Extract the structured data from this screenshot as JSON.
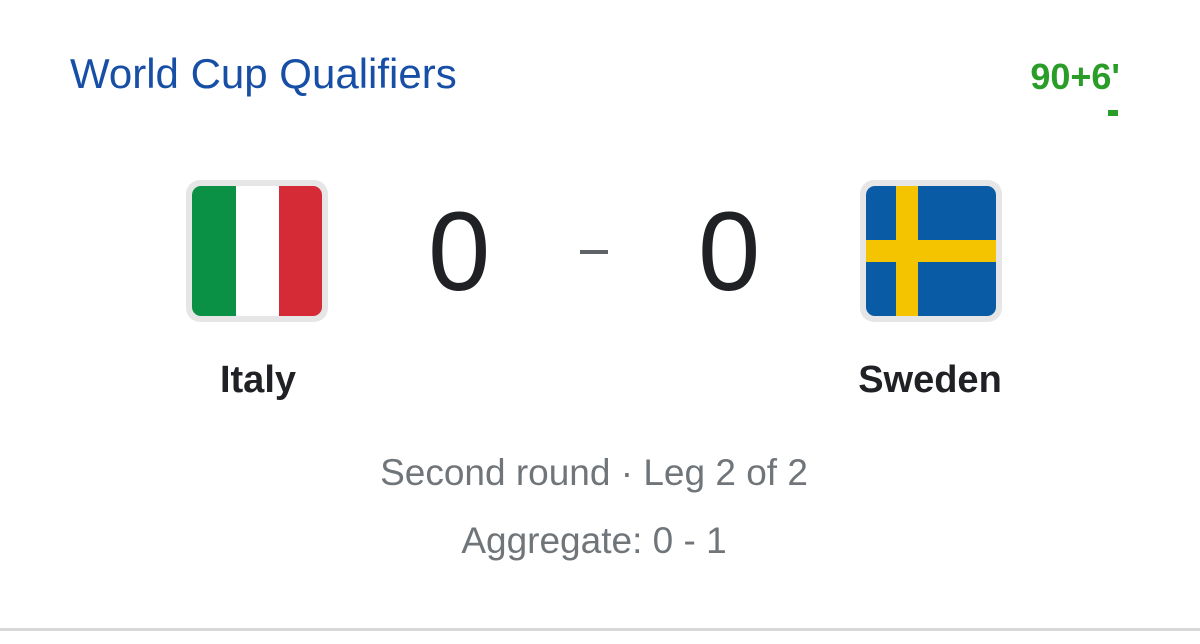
{
  "header": {
    "competition": "World Cup Qualifiers",
    "clock": "90+6'"
  },
  "match": {
    "home": {
      "name": "Italy",
      "score": "0",
      "flag": "italy-flag-icon",
      "colors": [
        "#0a9145",
        "#ffffff",
        "#d42b36"
      ]
    },
    "away": {
      "name": "Sweden",
      "score": "0",
      "flag": "sweden-flag-icon",
      "colors": [
        "#0a5ba5",
        "#f5c400"
      ]
    },
    "separator": "-"
  },
  "details": {
    "round": "Second round · Leg 2 of 2",
    "aggregate": "Aggregate: 0 - 1"
  },
  "colors": {
    "title": "#174ea6",
    "live": "#2a9d29",
    "score": "#202124",
    "secondary_text": "#70757a"
  }
}
